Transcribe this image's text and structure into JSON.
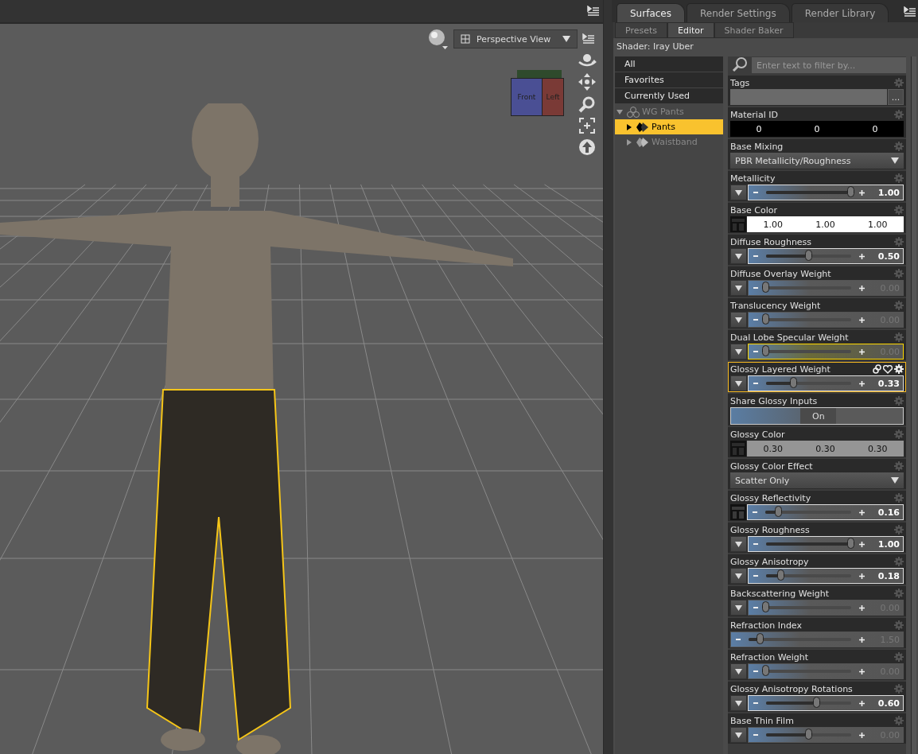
{
  "viewport": {
    "view_dropdown": "Perspective View",
    "cube_faces": [
      "Front",
      "Left"
    ]
  },
  "surfaces_panel": {
    "tabs": [
      {
        "label": "Surfaces",
        "selected": true
      },
      {
        "label": "Render Settings",
        "selected": false
      },
      {
        "label": "Render Library",
        "selected": false
      }
    ],
    "subtabs": [
      {
        "label": "Presets",
        "selected": false
      },
      {
        "label": "Editor",
        "selected": true
      },
      {
        "label": "Shader Baker",
        "selected": false
      }
    ],
    "shader_label": "Shader: Iray Uber",
    "filters": [
      {
        "label": "All",
        "selected": false
      },
      {
        "label": "Favorites",
        "selected": false
      },
      {
        "label": "Currently Used",
        "selected": false
      }
    ],
    "tree": [
      {
        "label": "WG Pants",
        "expanded": true,
        "selected": false,
        "dimmed": true,
        "children": [
          {
            "label": "Pants",
            "expanded": false,
            "selected": true,
            "dimmed": false
          },
          {
            "label": "Waistband",
            "expanded": false,
            "selected": false,
            "dimmed": true
          }
        ]
      }
    ],
    "filter_field": {
      "placeholder": "Enter text to filter by..."
    },
    "properties": [
      {
        "kind": "text",
        "label": "Tags",
        "button": "...",
        "selected": false
      },
      {
        "kind": "triple",
        "label": "Material ID",
        "values": [
          "0",
          "0",
          "0"
        ],
        "selected": false
      },
      {
        "kind": "dropdown",
        "label": "Base Mixing",
        "value": "PBR Metallicity/Roughness",
        "selected": false
      },
      {
        "kind": "slider",
        "label": "Metallicity",
        "menu_button": true,
        "mapped": false,
        "level": 1,
        "reading": "1.00",
        "modified": true,
        "selected": false,
        "focused": false
      },
      {
        "kind": "color",
        "label": "Base Color",
        "values": [
          "1.00",
          "1.00",
          "1.00"
        ],
        "color": "#ffffff",
        "selected": false
      },
      {
        "kind": "slider",
        "label": "Diffuse Roughness",
        "menu_button": true,
        "mapped": false,
        "level": 0.5,
        "reading": "0.50",
        "modified": true,
        "selected": false,
        "focused": false
      },
      {
        "kind": "slider",
        "label": "Diffuse Overlay Weight",
        "menu_button": true,
        "mapped": false,
        "level": 0,
        "reading": "0.00",
        "modified": false,
        "selected": false,
        "focused": false
      },
      {
        "kind": "slider",
        "label": "Translucency Weight",
        "menu_button": true,
        "mapped": false,
        "level": 0,
        "reading": "0.00",
        "modified": false,
        "selected": false,
        "focused": false
      },
      {
        "kind": "slider",
        "label": "Dual Lobe Specular Weight",
        "menu_button": true,
        "mapped": false,
        "level": 0,
        "reading": "0.00",
        "modified": false,
        "selected": false,
        "focused": true
      },
      {
        "kind": "slider",
        "label": "Glossy Layered Weight",
        "menu_button": true,
        "mapped": false,
        "level": 0.33,
        "reading": "0.33",
        "modified": true,
        "selected": true,
        "focused": false
      },
      {
        "kind": "toggle",
        "label": "Share Glossy Inputs",
        "on": true,
        "value": "On",
        "selected": false
      },
      {
        "kind": "color",
        "label": "Glossy Color",
        "values": [
          "0.30",
          "0.30",
          "0.30"
        ],
        "color": "#959595",
        "selected": false
      },
      {
        "kind": "dropdown",
        "label": "Glossy Color Effect",
        "value": "Scatter Only",
        "selected": false
      },
      {
        "kind": "slider",
        "label": "Glossy Reflectivity",
        "menu_button": false,
        "mapped": true,
        "level": 0.16,
        "reading": "0.16",
        "modified": true,
        "selected": false,
        "focused": false
      },
      {
        "kind": "slider",
        "label": "Glossy Roughness",
        "menu_button": true,
        "mapped": false,
        "level": 1,
        "reading": "1.00",
        "modified": true,
        "selected": false,
        "focused": false
      },
      {
        "kind": "slider",
        "label": "Glossy Anisotropy",
        "menu_button": true,
        "mapped": false,
        "level": 0.18,
        "reading": "0.18",
        "modified": true,
        "selected": false,
        "focused": false
      },
      {
        "kind": "slider",
        "label": "Backscattering Weight",
        "menu_button": true,
        "mapped": false,
        "level": 0,
        "reading": "0.00",
        "modified": false,
        "selected": false,
        "focused": false
      },
      {
        "kind": "slider",
        "label": "Refraction Index",
        "menu_button": false,
        "mapped": false,
        "level": 0.12,
        "reading": "1.50",
        "modified": false,
        "selected": false,
        "focused": false
      },
      {
        "kind": "slider",
        "label": "Refraction Weight",
        "menu_button": true,
        "mapped": false,
        "level": 0,
        "reading": "0.00",
        "modified": false,
        "selected": false,
        "focused": false
      },
      {
        "kind": "slider",
        "label": "Glossy Anisotropy Rotations",
        "menu_button": true,
        "mapped": false,
        "level": 0.6,
        "reading": "0.60",
        "modified": true,
        "selected": false,
        "focused": false
      },
      {
        "kind": "slider",
        "label": "Base Thin Film",
        "menu_button": true,
        "mapped": false,
        "level": 0.5,
        "reading": "0.00",
        "modified": false,
        "selected": false,
        "focused": false
      }
    ]
  }
}
